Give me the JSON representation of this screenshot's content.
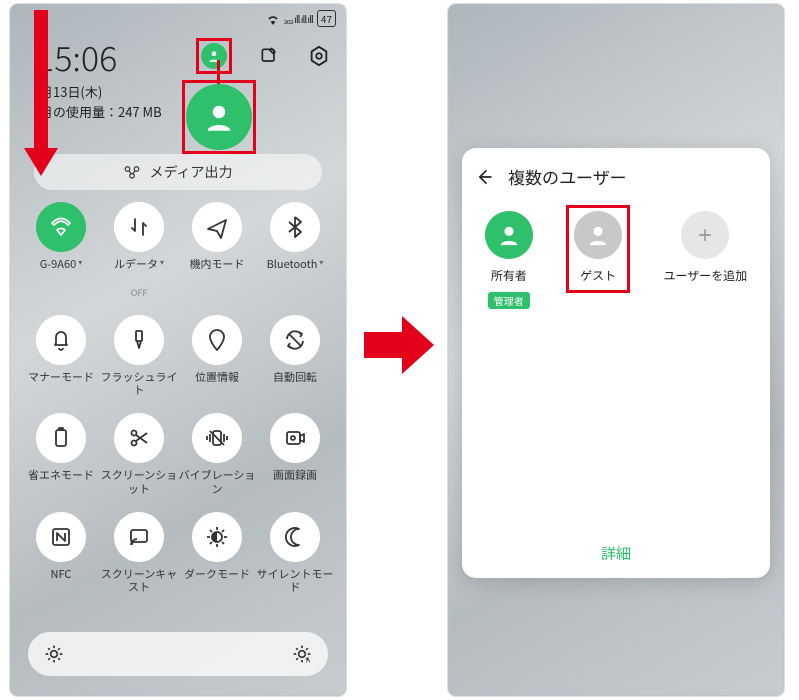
{
  "left": {
    "clock": "15:06",
    "date": "月13日(木)",
    "usage_label": "月の使用量：247 MB",
    "battery": "47",
    "media_output": "メディア出力",
    "tiles": [
      {
        "icon": "wifi",
        "label": "G-9A60",
        "active": true,
        "caret": true
      },
      {
        "icon": "arrows",
        "label": "ルデータ",
        "sublabel": "OFF",
        "caret": true
      },
      {
        "icon": "plane",
        "label": "機内モード"
      },
      {
        "icon": "bluetooth",
        "label": "Bluetooth",
        "caret": true
      },
      {
        "icon": "bell",
        "label": "マナーモード"
      },
      {
        "icon": "flash",
        "label": "フラッシュライト"
      },
      {
        "icon": "pin",
        "label": "位置情報"
      },
      {
        "icon": "rotate",
        "label": "自動回転"
      },
      {
        "icon": "battery",
        "label": "省エネモード"
      },
      {
        "icon": "scissors",
        "label": "スクリーンショット"
      },
      {
        "icon": "vibrate",
        "label": "バイブレーション"
      },
      {
        "icon": "record",
        "label": "画面録画"
      },
      {
        "icon": "nfc",
        "label": "NFC"
      },
      {
        "icon": "cast",
        "label": "スクリーンキャスト"
      },
      {
        "icon": "dark",
        "label": "ダークモード"
      },
      {
        "icon": "moon",
        "label": "サイレントモード"
      }
    ]
  },
  "right": {
    "sheet_title": "複数のユーザー",
    "owner_label": "所有者",
    "owner_badge": "管理者",
    "guest_label": "ゲスト",
    "add_label": "ユーザーを追加",
    "details": "詳細"
  }
}
